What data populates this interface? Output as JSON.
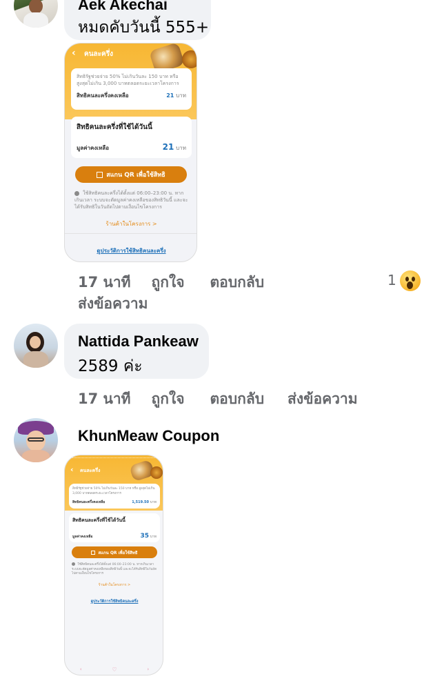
{
  "comments": [
    {
      "author": "Aek Akechai",
      "text": "หมดคับวันนี้ 555+",
      "actions": {
        "time": "17 นาที",
        "like": "ถูกใจ",
        "reply": "ตอบกลับ",
        "message": "ส่งข้อความ"
      },
      "reaction_count": "1",
      "reaction_icon": "surprised-emoji-icon",
      "attachment": {
        "title": "คนละครึ่ง",
        "note": "สิทธิรัฐช่วยจ่าย 50% ไม่เกินวันละ 150 บาท หรือ สูงสุดไม่เกิน 3,000 บาทตลอดระยะเวลาโครงการ",
        "remaining_label": "สิทธิคนละครึ่งคงเหลือ",
        "remaining_value": "21",
        "unit": "บาท",
        "today_title": "สิทธิคนละครึ่งที่ใช้ได้วันนี้",
        "today_label": "มูลค่าคงเหลือ",
        "today_value": "21",
        "qr_button": "สแกน QR เพื่อใช้สิทธิ",
        "info": "ใช้สิทธิคนละครึ่งได้ตั้งแต่ 06:00–23:00 น. หากเกินเวลา ระบบจะตัดมูลค่าคงเหลือของสิทธิวันนี้ และจะได้รับสิทธิในวันถัดไปตามเงื่อนไขโครงการ",
        "shops_link": "ร้านค้าในโครงการ >",
        "history_link": "ดูประวัติการใช้สิทธิคนละครึ่ง"
      }
    },
    {
      "author": "Nattida Pankeaw",
      "text": "2589 ค่ะ",
      "actions": {
        "time": "17 นาที",
        "like": "ถูกใจ",
        "reply": "ตอบกลับ",
        "message": "ส่งข้อความ"
      }
    },
    {
      "author": "KhunMeaw Coupon",
      "attachment": {
        "title": "คนละครึ่ง",
        "note": "สิทธิรัฐช่วยจ่าย 50% ไม่เกินวันละ 150 บาท หรือ สูงสุดไม่เกิน 3,000 บาทตลอดระยะเวลาโครงการ",
        "remaining_label": "สิทธิคนละครึ่งคงเหลือ",
        "remaining_value": "1,519.50",
        "unit": "บาท",
        "today_title": "สิทธิคนละครึ่งที่ใช้ได้วันนี้",
        "today_label": "มูลค่าคงเหลือ",
        "today_value": "35",
        "qr_button": "สแกน QR เพื่อใช้สิทธิ",
        "info": "ใช้สิทธิคนละครึ่งได้ตั้งแต่ 06:00–23:00 น. หากเกินเวลา ระบบจะตัดมูลค่าคงเหลือของสิทธิวันนี้ และจะได้รับสิทธิในวันถัดไปตามเงื่อนไขโครงการ",
        "shops_link": "ร้านค้าในโครงการ >",
        "history_link": "ดูประวัติการใช้สิทธิคนละครึ่ง"
      }
    }
  ],
  "colors": {
    "bubble": "#f0f2f5",
    "action_text": "#65676b",
    "app_orange": "#f7b733",
    "qr_button": "#d97f0e",
    "link_blue": "#1c6fb8"
  }
}
